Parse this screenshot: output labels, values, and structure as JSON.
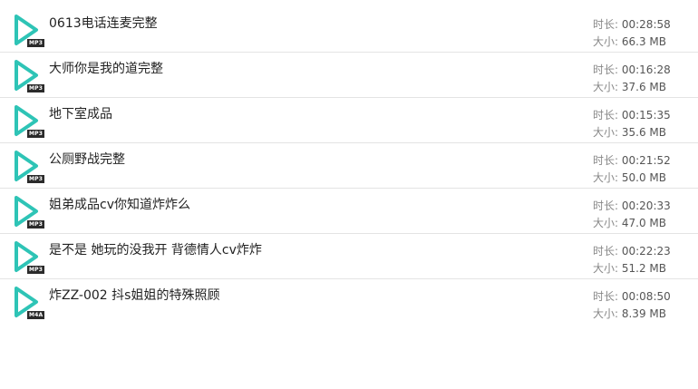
{
  "labels": {
    "duration": "时长: ",
    "size": "大小: "
  },
  "colors": {
    "play_icon": "#2ec4b6",
    "badge_bg": "#2b2b2b"
  },
  "files": [
    {
      "name": "0613电话连麦完整",
      "format": "MP3",
      "icon": "play-icon",
      "duration": "00:28:58",
      "size": "66.3 MB"
    },
    {
      "name": "大师你是我的道完整",
      "format": "MP3",
      "icon": "play-icon",
      "duration": "00:16:28",
      "size": "37.6 MB"
    },
    {
      "name": "地下室成品",
      "format": "MP3",
      "icon": "play-icon",
      "duration": "00:15:35",
      "size": "35.6 MB"
    },
    {
      "name": "公厕野战完整",
      "format": "MP3",
      "icon": "play-icon",
      "duration": "00:21:52",
      "size": "50.0 MB"
    },
    {
      "name": "姐弟成品cv你知道炸炸么",
      "format": "MP3",
      "icon": "play-icon",
      "duration": "00:20:33",
      "size": "47.0 MB"
    },
    {
      "name": "是不是 她玩的没我开 背德情人cv炸炸",
      "format": "MP3",
      "icon": "play-icon",
      "duration": "00:22:23",
      "size": "51.2 MB"
    },
    {
      "name": "炸ZZ-002  抖s姐姐的特殊照顾",
      "format": "M4A",
      "icon": "play-icon",
      "duration": "00:08:50",
      "size": "8.39 MB"
    }
  ]
}
